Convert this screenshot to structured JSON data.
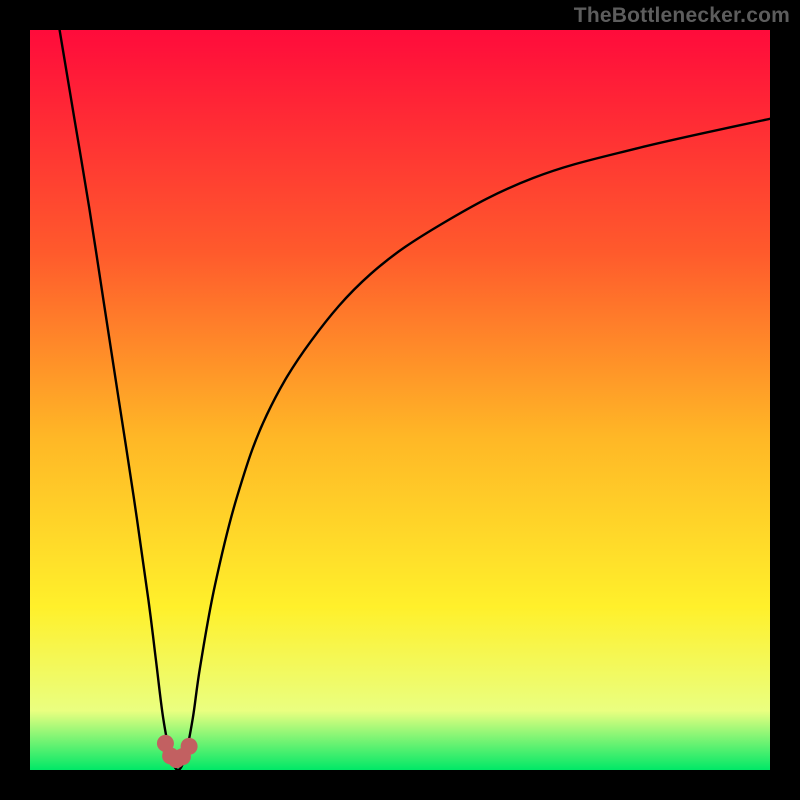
{
  "watermark": "TheBottlenecker.com",
  "chart_data": {
    "type": "line",
    "title": "",
    "xlabel": "",
    "ylabel": "",
    "xlim": [
      0,
      100
    ],
    "ylim": [
      0,
      100
    ],
    "background_gradient": {
      "top": "#ff0b3b",
      "mid_upper": "#ff5a2c",
      "mid": "#ffb726",
      "mid_lower": "#fff02b",
      "near_bottom": "#eaff80",
      "bottom": "#00e867"
    },
    "optimum_x": 20,
    "scatter_color": "#c26061",
    "series": [
      {
        "name": "bottleneck-curve",
        "x": [
          4,
          6,
          8,
          10,
          12,
          14,
          16,
          17,
          18,
          19,
          20,
          21,
          22,
          23,
          25,
          28,
          32,
          38,
          46,
          56,
          68,
          82,
          100
        ],
        "y": [
          100,
          88,
          76,
          63,
          50,
          37,
          23,
          15,
          7,
          2,
          0,
          2,
          7,
          14,
          25,
          37,
          48,
          58,
          67,
          74,
          80,
          84,
          88
        ]
      }
    ],
    "scatter": {
      "name": "sample-points",
      "x": [
        18.3,
        19.0,
        19.8,
        20.6,
        21.5
      ],
      "y": [
        3.6,
        1.9,
        1.4,
        1.8,
        3.2
      ]
    }
  }
}
